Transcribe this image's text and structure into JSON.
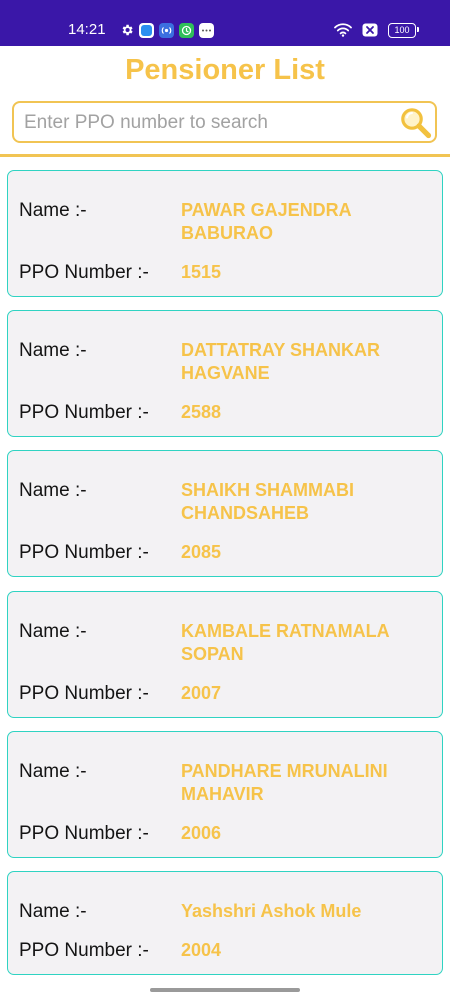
{
  "status_bar": {
    "time": "14:21",
    "battery": "100",
    "icons_left": [
      "gear-icon",
      "app-icon-blue",
      "app-icon-radio",
      "app-icon-green",
      "app-icon-dots"
    ],
    "icons_right": [
      "wifi-icon",
      "close-box-icon",
      "battery-icon"
    ]
  },
  "header": {
    "title": "Pensioner List"
  },
  "search": {
    "placeholder": "Enter PPO number to search",
    "value": ""
  },
  "labels": {
    "name": "Name :-",
    "ppo": "PPO Number :-"
  },
  "pensioners": [
    {
      "name_line1": "PAWAR GAJENDRA",
      "name_line2": "BABURAO",
      "ppo": "1515"
    },
    {
      "name_line1": "DATTATRAY SHANKAR",
      "name_line2": "HAGVANE",
      "ppo": "2588"
    },
    {
      "name_line1": "SHAIKH SHAMMABI",
      "name_line2": "CHANDSAHEB",
      "ppo": "2085"
    },
    {
      "name_line1": "KAMBALE RATNAMALA",
      "name_line2": "SOPAN",
      "ppo": "2007"
    },
    {
      "name_line1": "PANDHARE MRUNALINI",
      "name_line2": "MAHAVIR",
      "ppo": "2006"
    },
    {
      "name_line1": "Yashshri Ashok Mule",
      "name_line2": "",
      "ppo": "2004"
    }
  ],
  "colors": {
    "status_bar": "#3a17a8",
    "accent": "#f6c34a",
    "card_border": "#2fd3c2",
    "card_bg": "#f3f2f4"
  }
}
